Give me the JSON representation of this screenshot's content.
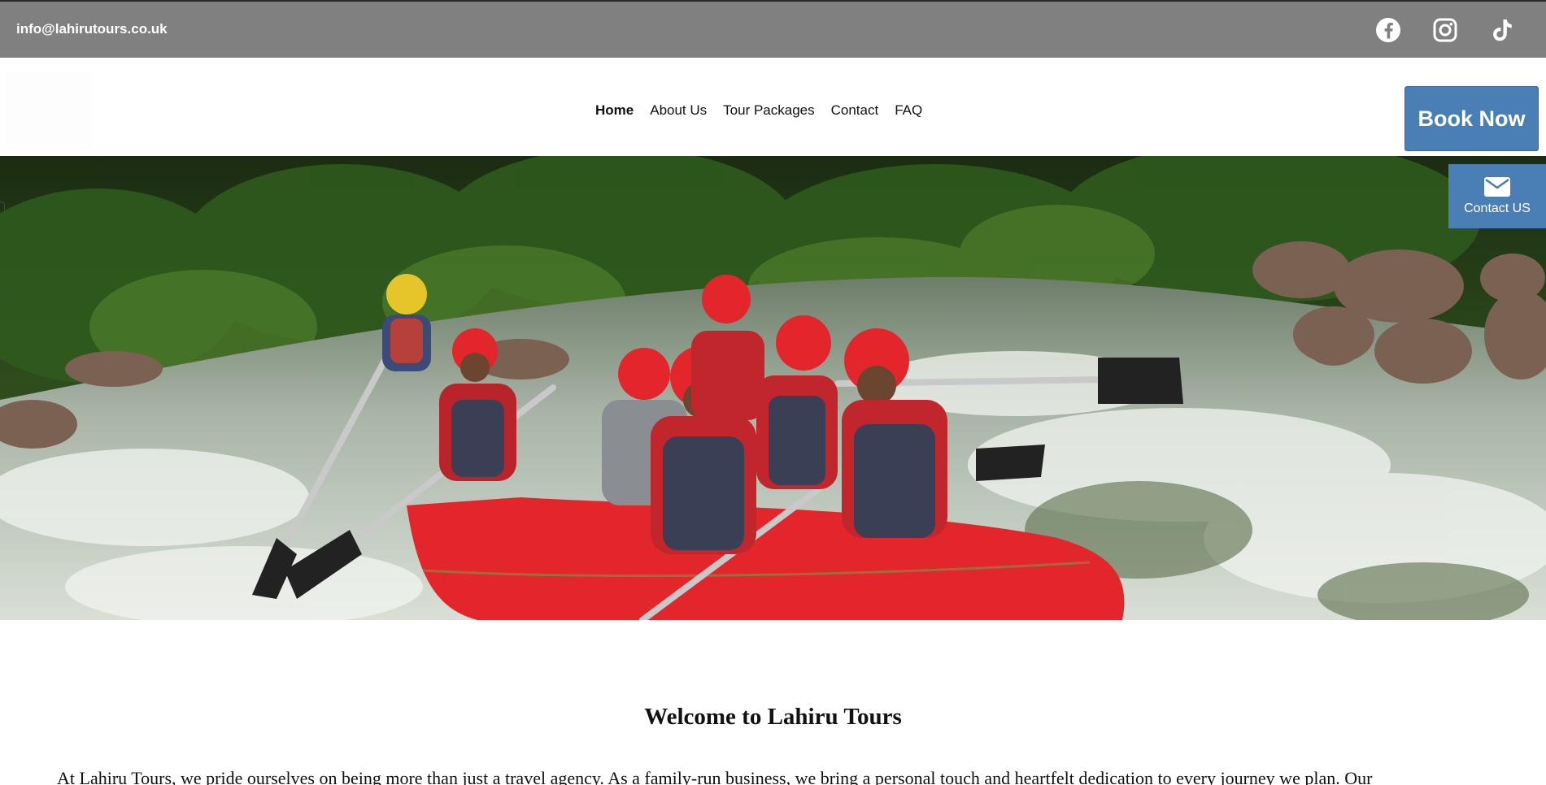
{
  "topbar": {
    "email": "info@lahirutours.co.uk",
    "social": [
      {
        "icon": "facebook-icon"
      },
      {
        "icon": "instagram-icon"
      },
      {
        "icon": "tiktok-icon"
      }
    ]
  },
  "nav": {
    "items": [
      {
        "label": "Home",
        "active": true
      },
      {
        "label": "About Us",
        "active": false
      },
      {
        "label": "Tour Packages",
        "active": false
      },
      {
        "label": "Contact",
        "active": false
      },
      {
        "label": "FAQ",
        "active": false
      }
    ]
  },
  "cta": {
    "book_now": "Book Now",
    "contact_us": "Contact US"
  },
  "hero": {
    "icon": "white-water-rafting-photo"
  },
  "content": {
    "title": "Welcome to Lahiru Tours",
    "intro": "At Lahiru Tours, we pride ourselves on being more than just a travel agency. As a family-run business, we bring a personal touch and heartfelt dedication to every journey we plan. Our"
  },
  "colors": {
    "topbar": "#808080",
    "accent": "#4a7fb5",
    "raft": "#e3262b"
  }
}
